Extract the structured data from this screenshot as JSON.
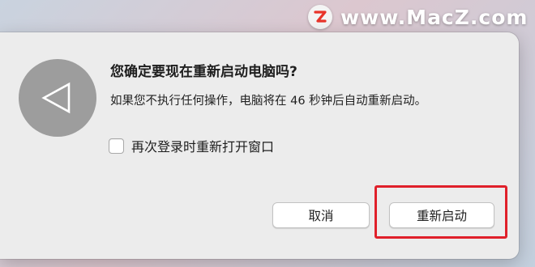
{
  "watermark": {
    "logo_icon": "z-logo-icon",
    "text": "www.MacZ.com",
    "accent_color": "#e8342a"
  },
  "dialog": {
    "icon": "left-triangle-icon",
    "title": "您确定要现在重新启动电脑吗?",
    "message": "如果您不执行任何操作，电脑将在 46 秒钟后自动重新启动。",
    "checkbox": {
      "label": "再次登录时重新打开窗口",
      "checked": false
    },
    "buttons": {
      "cancel_label": "取消",
      "restart_label": "重新启动"
    },
    "highlight_color": "#e0202a"
  }
}
